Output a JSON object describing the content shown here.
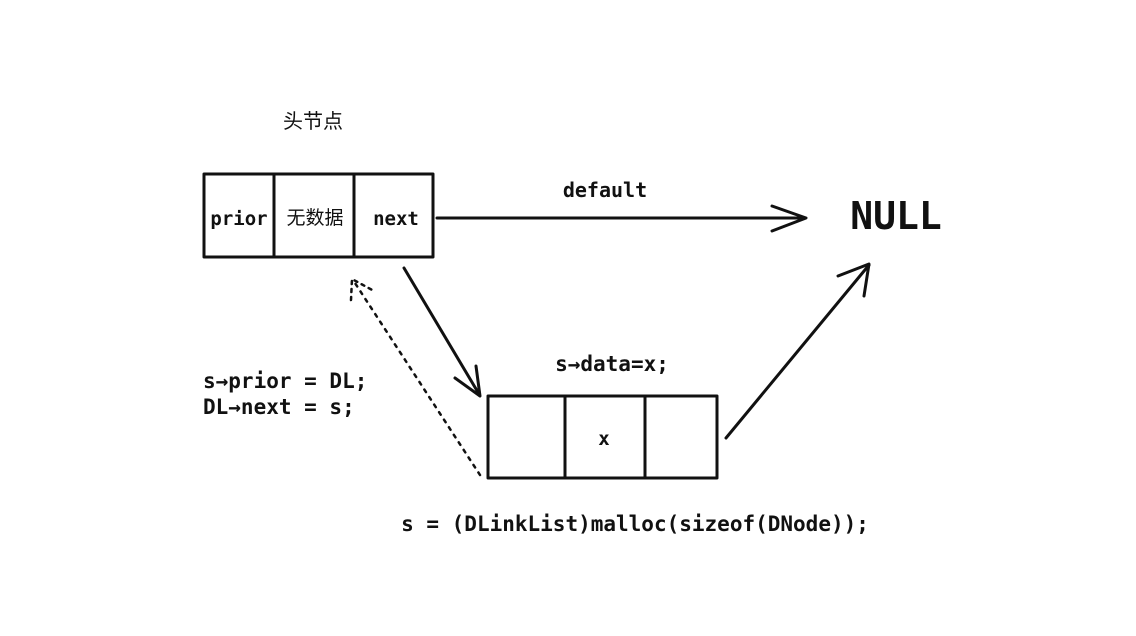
{
  "head_node": {
    "title": "头节点",
    "cells": [
      "prior",
      "无数据",
      "next"
    ]
  },
  "default_label": "default",
  "null_label": "NULL",
  "new_node": {
    "data_label": "s→data=x;",
    "cells": [
      "",
      "x",
      ""
    ]
  },
  "link_code": {
    "line1": "s→prior = DL;",
    "line2": "DL→next = s;"
  },
  "malloc_code": "s = (DLinkList)malloc(sizeof(DNode));"
}
